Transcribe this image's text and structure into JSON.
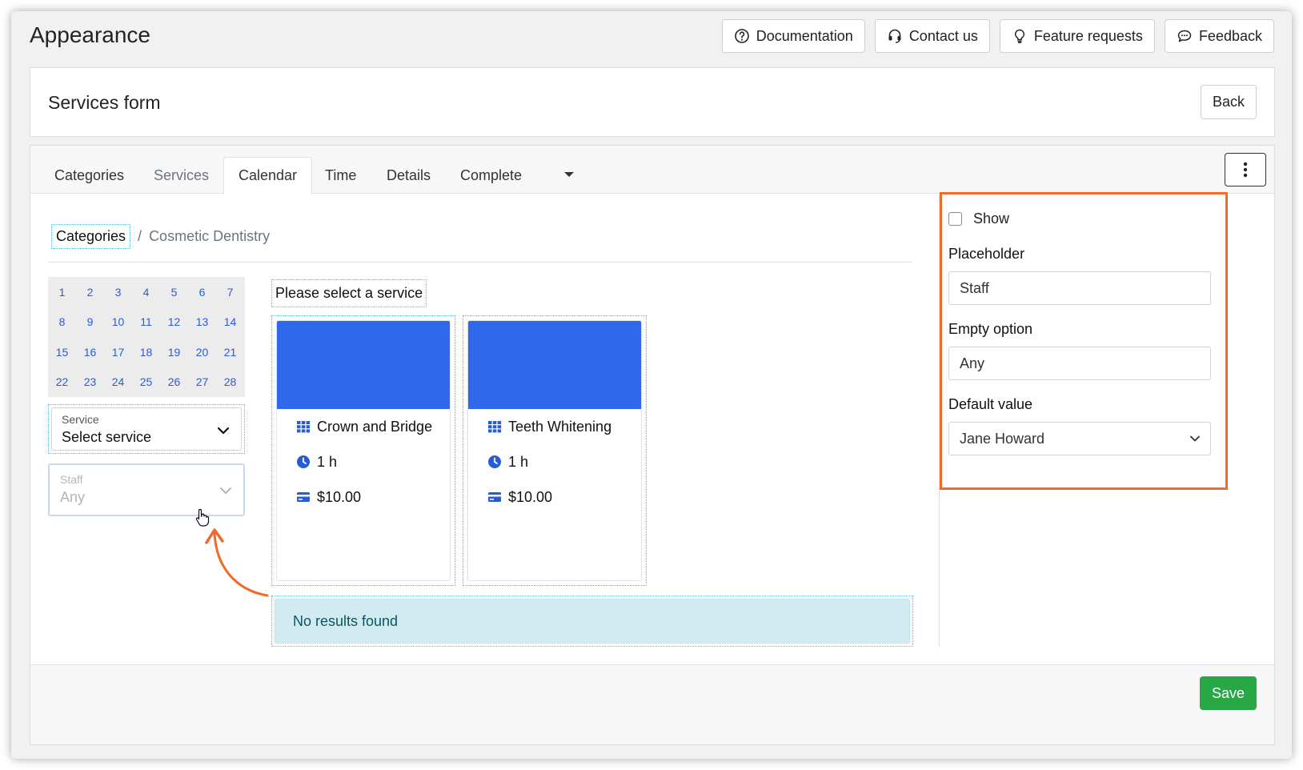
{
  "page": {
    "title": "Appearance"
  },
  "top_buttons": [
    {
      "label": "Documentation",
      "icon": "question-circle-icon"
    },
    {
      "label": "Contact us",
      "icon": "headset-icon"
    },
    {
      "label": "Feature requests",
      "icon": "lightbulb-icon"
    },
    {
      "label": "Feedback",
      "icon": "chat-bubble-icon"
    }
  ],
  "header": {
    "title": "Services form",
    "back_label": "Back"
  },
  "tabs": [
    {
      "label": "Categories"
    },
    {
      "label": "Services"
    },
    {
      "label": "Calendar"
    },
    {
      "label": "Time"
    },
    {
      "label": "Details"
    },
    {
      "label": "Complete"
    }
  ],
  "breadcrumb": {
    "root": "Categories",
    "separator": "/",
    "current": "Cosmetic Dentistry"
  },
  "calendar": {
    "rows": [
      [
        "1",
        "2",
        "3",
        "4",
        "5",
        "6",
        "7"
      ],
      [
        "8",
        "9",
        "10",
        "11",
        "12",
        "13",
        "14"
      ],
      [
        "15",
        "16",
        "17",
        "18",
        "19",
        "20",
        "21"
      ],
      [
        "22",
        "23",
        "24",
        "25",
        "26",
        "27",
        "28"
      ]
    ]
  },
  "service_select": {
    "label": "Service",
    "value": "Select service"
  },
  "staff_select": {
    "label": "Staff",
    "value": "Any"
  },
  "services": {
    "heading": "Please select a service",
    "items": [
      {
        "name": "Crown and Bridge",
        "duration": "1 h",
        "price": "$10.00"
      },
      {
        "name": "Teeth Whitening",
        "duration": "1 h",
        "price": "$10.00"
      }
    ],
    "image_color": "#2e68eb"
  },
  "no_results": "No results found",
  "settings": {
    "show_label": "Show",
    "placeholder_label": "Placeholder",
    "placeholder_value": "Staff",
    "empty_option_label": "Empty option",
    "empty_option_value": "Any",
    "default_value_label": "Default value",
    "default_value": "Jane Howard",
    "highlight_color": "#f06a2a"
  },
  "footer": {
    "save_label": "Save"
  },
  "colors": {
    "accent_blue": "#2a5bd7",
    "save_green": "#28a745"
  }
}
